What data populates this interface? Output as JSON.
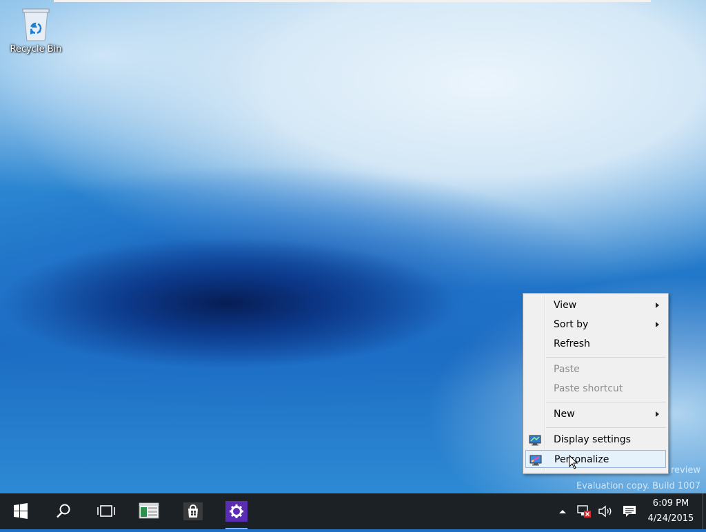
{
  "desktop": {
    "icons": [
      {
        "label": "Recycle Bin",
        "icon": "recycle-bin-icon"
      }
    ],
    "watermark": {
      "line1": "review",
      "line2": "Evaluation copy. Build 1007"
    }
  },
  "context_menu": {
    "items": [
      {
        "label": "View",
        "submenu": true
      },
      {
        "label": "Sort by",
        "submenu": true
      },
      {
        "label": "Refresh"
      },
      {
        "label": "Paste",
        "disabled": true
      },
      {
        "label": "Paste shortcut",
        "disabled": true
      },
      {
        "label": "New",
        "submenu": true
      },
      {
        "label": "Display settings",
        "icon": "monitor-icon"
      },
      {
        "label": "Personalize",
        "icon": "monitor-paint-icon",
        "highlighted": true
      }
    ]
  },
  "taskbar": {
    "buttons": [
      "start-icon",
      "search-icon",
      "task-view-icon",
      "file-explorer-icon",
      "store-icon",
      "settings-icon"
    ],
    "tray": {
      "icons": [
        "chevron-up-icon",
        "network-error-icon",
        "volume-icon",
        "action-center-icon"
      ],
      "time": "6:09 PM",
      "date": "4/24/2015"
    }
  },
  "colors": {
    "accent": "#5b2db5",
    "taskbar": "#1c2126",
    "menu_highlight": "#e5f1fb"
  }
}
